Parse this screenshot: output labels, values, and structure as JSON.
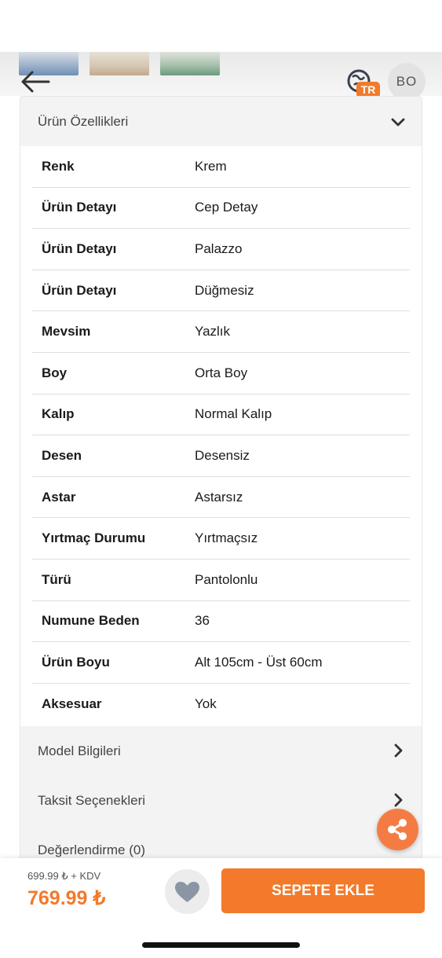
{
  "header": {
    "language_badge": "TR",
    "avatar_initials": "BO"
  },
  "product_features": {
    "title": "Ürün Özellikleri",
    "rows": [
      {
        "key": "Renk",
        "value": "Krem"
      },
      {
        "key": "Ürün Detayı",
        "value": "Cep Detay"
      },
      {
        "key": "Ürün Detayı",
        "value": "Palazzo"
      },
      {
        "key": "Ürün Detayı",
        "value": "Düğmesiz"
      },
      {
        "key": "Mevsim",
        "value": "Yazlık"
      },
      {
        "key": "Boy",
        "value": "Orta Boy"
      },
      {
        "key": "Kalıp",
        "value": "Normal Kalıp"
      },
      {
        "key": "Desen",
        "value": "Desensiz"
      },
      {
        "key": "Astar",
        "value": "Astarsız"
      },
      {
        "key": "Yırtmaç Durumu",
        "value": "Yırtmaçsız"
      },
      {
        "key": "Türü",
        "value": "Pantolonlu"
      },
      {
        "key": "Numune Beden",
        "value": "36"
      },
      {
        "key": "Ürün Boyu",
        "value": "Alt 105cm - Üst 60cm"
      },
      {
        "key": "Aksesuar",
        "value": "Yok"
      }
    ]
  },
  "sections": [
    {
      "label": "Model Bilgileri"
    },
    {
      "label": "Taksit Seçenekleri"
    },
    {
      "label": "Değerlendirme (0)"
    }
  ],
  "purchase": {
    "price_before_tax": "699.99 ₺ + KDV",
    "price": "769.99 ₺",
    "add_to_cart_label": "SEPETE EKLE"
  },
  "colors": {
    "accent": "#f27a2a",
    "share_button": "#f47c44"
  },
  "icons": [
    "back-arrow-icon",
    "globe-icon",
    "chevron-down-icon",
    "chevron-right-icon",
    "share-icon",
    "heart-icon"
  ]
}
